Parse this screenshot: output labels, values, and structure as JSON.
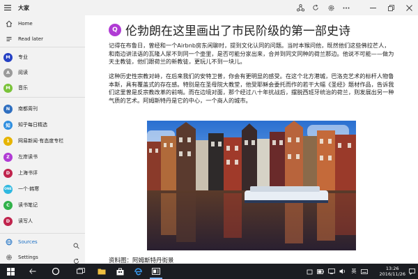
{
  "window": {
    "title": "大家"
  },
  "sidebar": {
    "top_items": [
      {
        "label": "Home",
        "icon": "home-icon"
      },
      {
        "label": "Read later",
        "icon": "read-later-icon"
      }
    ],
    "categories": [
      {
        "label": "专业",
        "badge": "M",
        "color": "#2440c4"
      },
      {
        "label": "阅读",
        "badge": "A",
        "color": "#9a9a9a"
      },
      {
        "label": "音乐",
        "badge": "M",
        "color": "#7ac33a"
      }
    ],
    "feeds": [
      {
        "label": "南都周刊",
        "badge": "N",
        "color": "#2f6fc0"
      },
      {
        "label": "知乎每日精选",
        "badge": "知",
        "color": "#2f8fe0"
      },
      {
        "label": "网易新闻·有态度专栏",
        "badge": "1",
        "color": "#e6b400"
      },
      {
        "label": "左岸读书",
        "badge": "Z",
        "color": "#b03bd4"
      },
      {
        "label": "上海书评",
        "badge": "D",
        "color": "#c0244d"
      },
      {
        "label": "一个·韩寒",
        "badge": "ONE",
        "color": "#2fb8e0"
      },
      {
        "label": "读书笔记",
        "badge": "C",
        "color": "#31b24a"
      },
      {
        "label": "读写人",
        "badge": "D",
        "color": "#c0244d"
      }
    ],
    "sources_label": "Sources",
    "settings_label": "Settings"
  },
  "article": {
    "badge": "Q",
    "title": "伦勃朗在这里画出了市民阶级的第一部史诗",
    "paragraphs": [
      "记得在布鲁日，曾经和一个Airbnb房东闲聊时，提到文化认同的问题。当时本猴问他，既然他们这些佛拉芒人，和南边讲法语的瓦隆人尿不到同一个壶里，是否可能分家出来，合并到同文同种的荷兰那边。他说不可能——做为天主教徒，他们跟荷兰的新教徒，更玩儿不到一块儿。",
      "这种历史性宗教对峙，在后来我们的安特卫普，你会有更明显的感受。在这个北方港城，巴洛克艺术的标杆人物鲁本斯，具有覆盖式的存在感。特别是在圣母院大教堂，他受耶稣会委托而作的若干大幅《圣经》题材作品，告诉我们这里曾是反宗教改革的前哨。而在边境对面，那个经过八十年抗战后，摆脱西班牙统治的荷兰，则发展出另一种气质的艺术。阿姆斯特丹是它的中心，一个商人的城市。"
    ],
    "caption": "资料图：阿姆斯特丹街景"
  },
  "taskbar": {
    "time": "13:26",
    "date": "2016/11/26",
    "ime_label": "英"
  },
  "colors": {
    "sidebar_bg": "#f2f2f2",
    "accent": "#1a6fc4",
    "taskbar_bg": "#1b1d22"
  }
}
